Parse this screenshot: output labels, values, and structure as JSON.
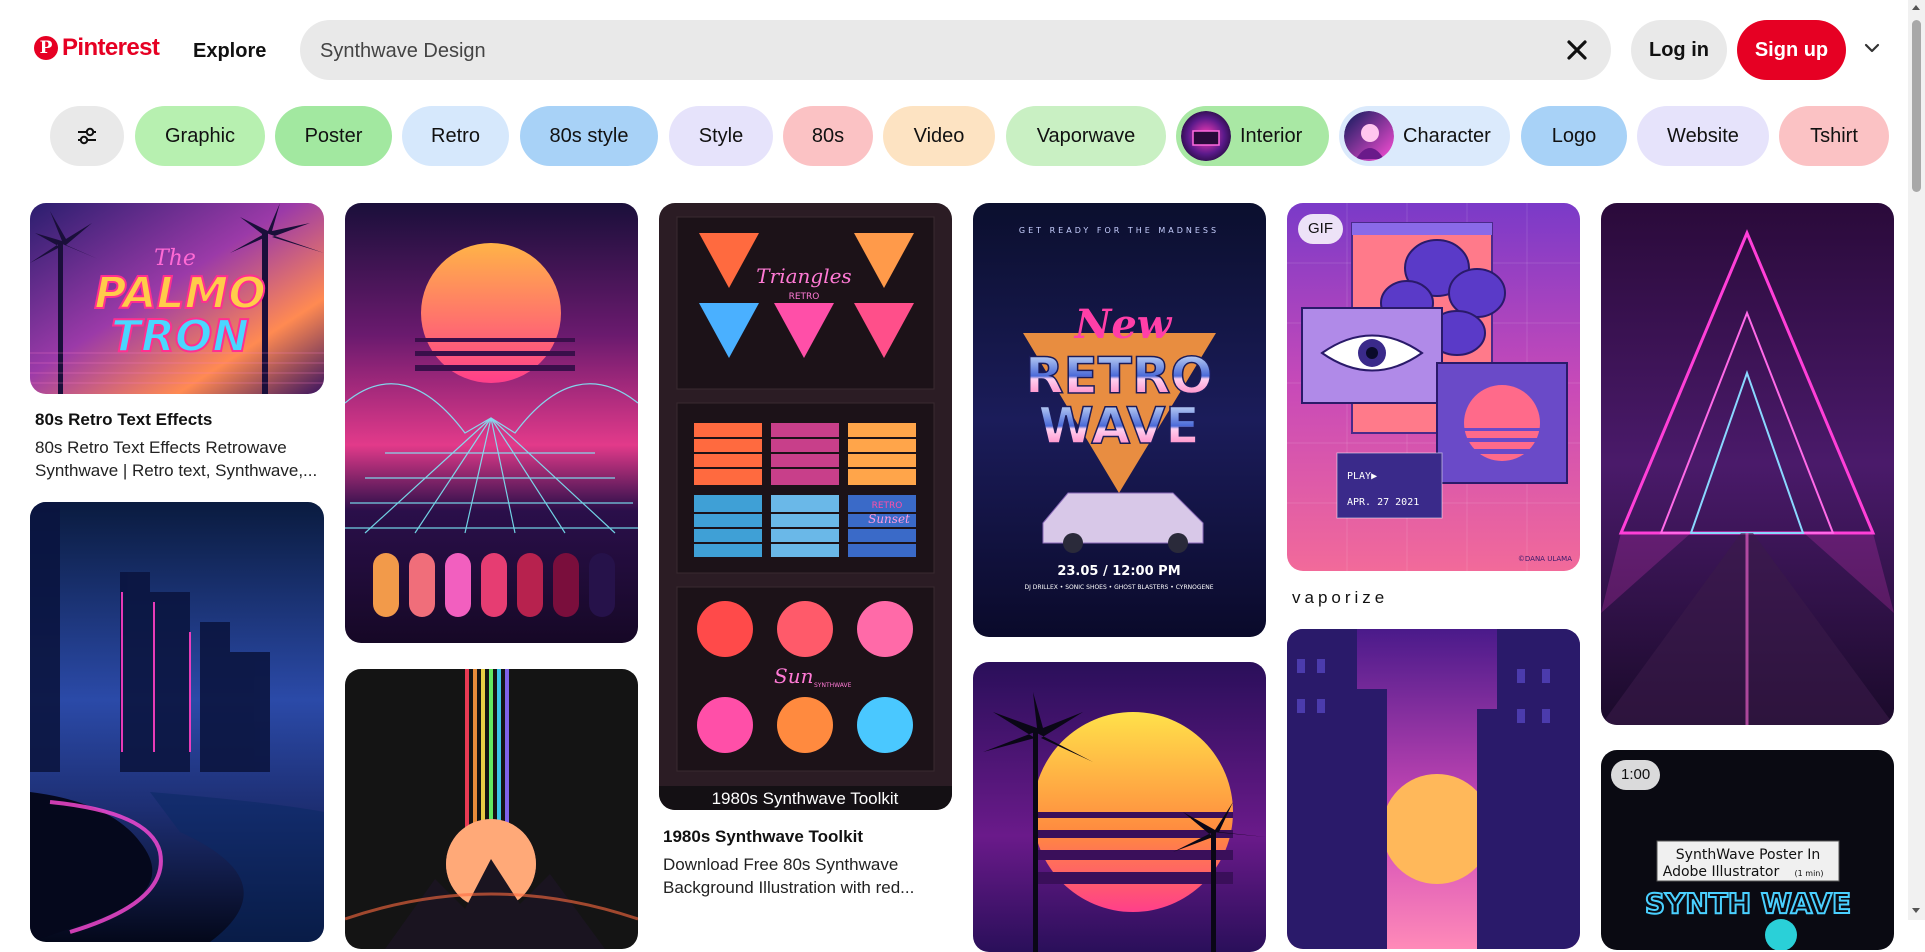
{
  "header": {
    "logo_text": "Pinterest",
    "explore_label": "Explore",
    "search_value": "Synthwave Design",
    "login_label": "Log in",
    "signup_label": "Sign up"
  },
  "chips": [
    {
      "label": "Graphic",
      "color": "#b7f0b0"
    },
    {
      "label": "Poster",
      "color": "#a2e8a0"
    },
    {
      "label": "Retro",
      "color": "#d6e8fc"
    },
    {
      "label": "80s style",
      "color": "#a8d2f7"
    },
    {
      "label": "Style",
      "color": "#e6e3fb"
    },
    {
      "label": "80s",
      "color": "#fbc2c4"
    },
    {
      "label": "Video",
      "color": "#fde3c2"
    },
    {
      "label": "Vaporwave",
      "color": "#c9f0c3"
    },
    {
      "label": "Interior",
      "color": "#a9e8a4"
    },
    {
      "label": "Character",
      "color": "#dbeafc"
    },
    {
      "label": "Logo",
      "color": "#a8d2f7"
    },
    {
      "label": "Website",
      "color": "#e6e3fb"
    },
    {
      "label": "Tshirt",
      "color": "#fbc2c4"
    }
  ],
  "pins": {
    "p1_title": "80s Retro Text Effects",
    "p1_desc": "80s Retro Text Effects Retrowave Synthwave | Retro text, Synthwave,...",
    "p1_art_lines": [
      "The",
      "PALMO",
      "TRON"
    ],
    "p3_caption": "1980s Synthwave Toolkit",
    "p3_title": "1980s Synthwave Toolkit",
    "p3_desc": "Download Free 80s Synthwave Background Illustration with red...",
    "p3_art": [
      "Triangles",
      "RETRO",
      "RETRO",
      "Sunset",
      "Sun",
      "SYNTHWAVE"
    ],
    "p4_art": [
      "GET READY FOR THE MADNESS",
      "New",
      "RETRO",
      "WAVE",
      "23.05 / 12:00 PM",
      "DJ DRILLEX • SONIC SHOES • GHOST BLASTERS • CYRNOGENE"
    ],
    "p5_badge": "GIF",
    "p5_title": "vaporize",
    "p5_art": [
      "PLAY▶",
      "APR. 27 2021",
      "©DANA ULAMA"
    ],
    "p6_badge": "1:00",
    "p6_art": [
      "SynthWave Poster In",
      "Adobe Illustrator",
      "(1 min)",
      "SYNTH WAVE"
    ]
  }
}
